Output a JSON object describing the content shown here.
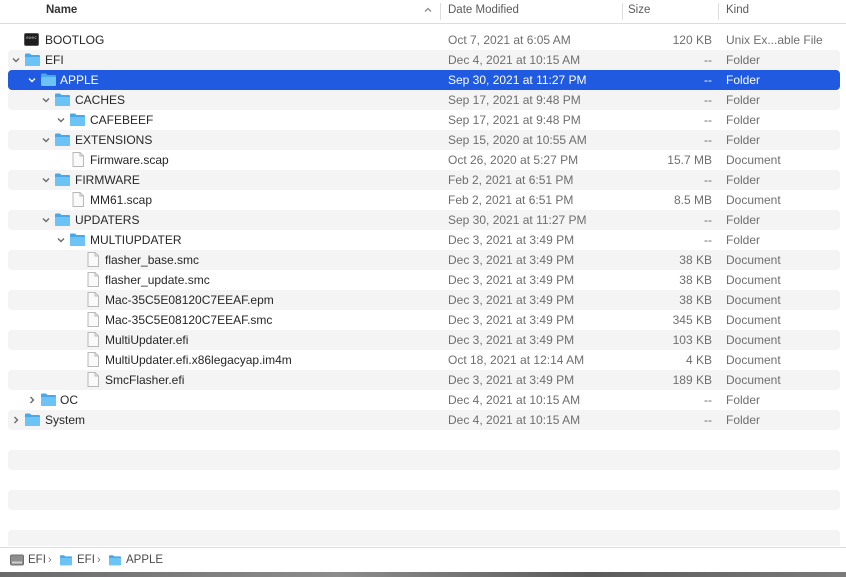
{
  "columns": {
    "name": "Name",
    "date": "Date Modified",
    "size": "Size",
    "kind": "Kind"
  },
  "rows": [
    {
      "name": "BOOTLOG",
      "date": "Oct 7, 2021 at 6:05 AM",
      "size": "120 KB",
      "kind": "Unix Ex...able File",
      "icon": "terminal-icon",
      "disclosure": "none"
    },
    {
      "name": "EFI",
      "date": "Dec 4, 2021 at 10:15 AM",
      "size": "--",
      "kind": "Folder",
      "icon": "folder-icon",
      "disclosure": "expanded"
    },
    {
      "name": "APPLE",
      "date": "Sep 30, 2021 at 11:27 PM",
      "size": "--",
      "kind": "Folder",
      "icon": "folder-icon",
      "disclosure": "expanded",
      "selected": true
    },
    {
      "name": "CACHES",
      "date": "Sep 17, 2021 at 9:48 PM",
      "size": "--",
      "kind": "Folder",
      "icon": "folder-icon",
      "disclosure": "expanded"
    },
    {
      "name": "CAFEBEEF",
      "date": "Sep 17, 2021 at 9:48 PM",
      "size": "--",
      "kind": "Folder",
      "icon": "folder-icon",
      "disclosure": "expanded"
    },
    {
      "name": "EXTENSIONS",
      "date": "Sep 15, 2020 at 10:55 AM",
      "size": "--",
      "kind": "Folder",
      "icon": "folder-icon",
      "disclosure": "expanded"
    },
    {
      "name": "Firmware.scap",
      "date": "Oct 26, 2020 at 5:27 PM",
      "size": "15.7 MB",
      "kind": "Document",
      "icon": "document-icon",
      "disclosure": "none"
    },
    {
      "name": "FIRMWARE",
      "date": "Feb 2, 2021 at 6:51 PM",
      "size": "--",
      "kind": "Folder",
      "icon": "folder-icon",
      "disclosure": "expanded"
    },
    {
      "name": "MM61.scap",
      "date": "Feb 2, 2021 at 6:51 PM",
      "size": "8.5 MB",
      "kind": "Document",
      "icon": "document-icon",
      "disclosure": "none"
    },
    {
      "name": "UPDATERS",
      "date": "Sep 30, 2021 at 11:27 PM",
      "size": "--",
      "kind": "Folder",
      "icon": "folder-icon",
      "disclosure": "expanded"
    },
    {
      "name": "MULTIUPDATER",
      "date": "Dec 3, 2021 at 3:49 PM",
      "size": "--",
      "kind": "Folder",
      "icon": "folder-icon",
      "disclosure": "expanded"
    },
    {
      "name": "flasher_base.smc",
      "date": "Dec 3, 2021 at 3:49 PM",
      "size": "38 KB",
      "kind": "Document",
      "icon": "document-icon",
      "disclosure": "none"
    },
    {
      "name": "flasher_update.smc",
      "date": "Dec 3, 2021 at 3:49 PM",
      "size": "38 KB",
      "kind": "Document",
      "icon": "document-icon",
      "disclosure": "none"
    },
    {
      "name": "Mac-35C5E08120C7EEAF.epm",
      "date": "Dec 3, 2021 at 3:49 PM",
      "size": "38 KB",
      "kind": "Document",
      "icon": "document-icon",
      "disclosure": "none"
    },
    {
      "name": "Mac-35C5E08120C7EEAF.smc",
      "date": "Dec 3, 2021 at 3:49 PM",
      "size": "345 KB",
      "kind": "Document",
      "icon": "document-icon",
      "disclosure": "none"
    },
    {
      "name": "MultiUpdater.efi",
      "date": "Dec 3, 2021 at 3:49 PM",
      "size": "103 KB",
      "kind": "Document",
      "icon": "document-icon",
      "disclosure": "none"
    },
    {
      "name": "MultiUpdater.efi.x86legacyap.im4m",
      "date": "Oct 18, 2021 at 12:14 AM",
      "size": "4 KB",
      "kind": "Document",
      "icon": "document-icon",
      "disclosure": "none"
    },
    {
      "name": "SmcFlasher.efi",
      "date": "Dec 3, 2021 at 3:49 PM",
      "size": "189 KB",
      "kind": "Document",
      "icon": "document-icon",
      "disclosure": "none"
    },
    {
      "name": "OC",
      "date": "Dec 4, 2021 at 10:15 AM",
      "size": "--",
      "kind": "Folder",
      "icon": "folder-icon",
      "disclosure": "collapsed"
    },
    {
      "name": "System",
      "date": "Dec 4, 2021 at 10:15 AM",
      "size": "--",
      "kind": "Folder",
      "icon": "folder-icon",
      "disclosure": "collapsed"
    }
  ],
  "pathbar": [
    "EFI",
    "EFI",
    "APPLE"
  ],
  "colors": {
    "selection": "#1f5ae0",
    "folder": "#5ab8f0",
    "alt_row": "#f4f4f5"
  }
}
